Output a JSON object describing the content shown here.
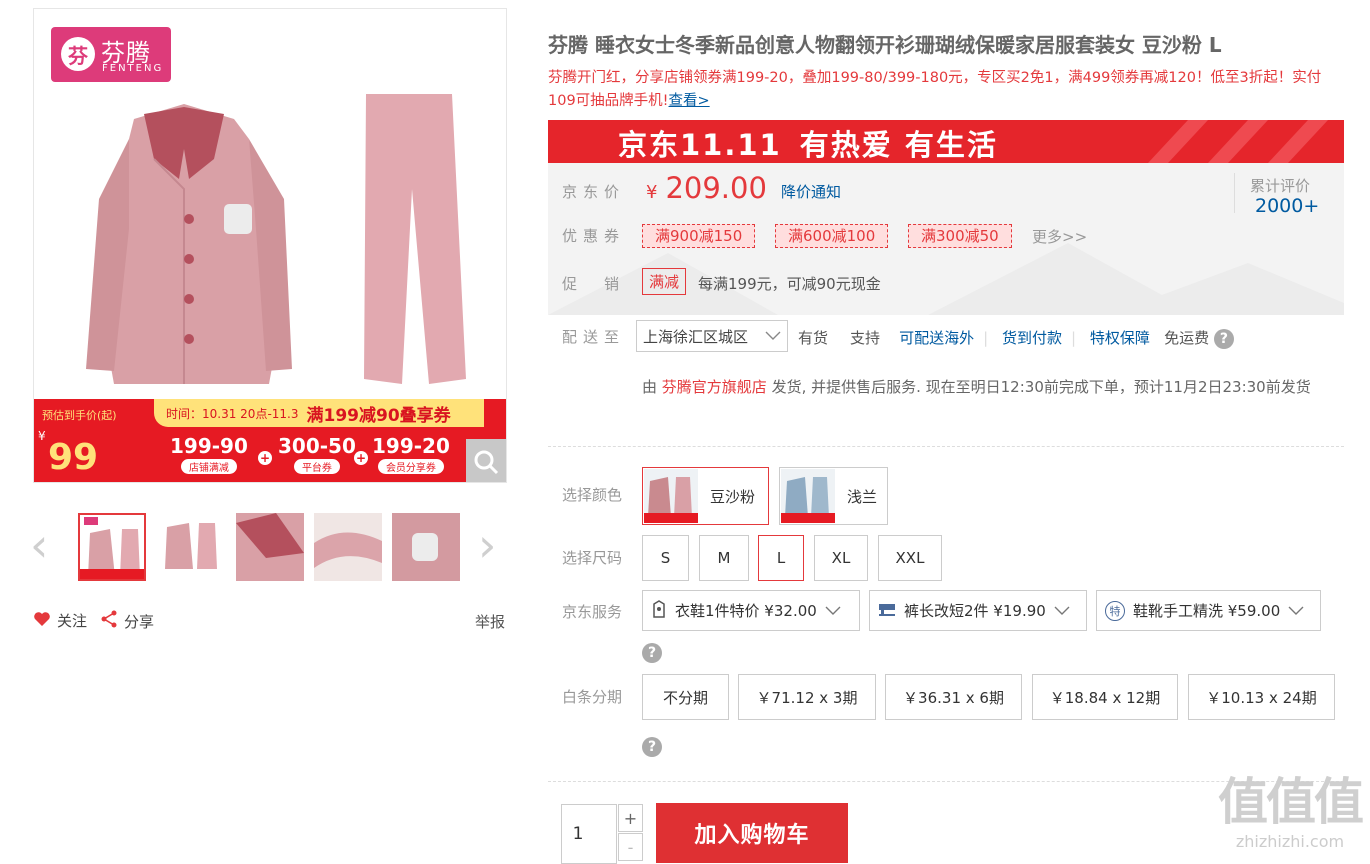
{
  "gallery": {
    "brand_logo": {
      "cn": "芬腾",
      "en": "FENTENG",
      "mark": "芬"
    },
    "promo_banner": {
      "estimate_label": "预估到手价(起)",
      "currency": "¥",
      "estimate_price": "99",
      "time_text": "时间：10.31 20点-11.3",
      "headline": "满199减90叠享券",
      "segments": [
        {
          "amount": "199-90",
          "sub": "店铺满减"
        },
        {
          "amount": "300-50",
          "sub": "平台券"
        },
        {
          "amount": "199-20",
          "sub": "会员分享券"
        }
      ],
      "plus": "+"
    },
    "zoom_icon": "magnifier-icon",
    "prev_arrow": "‹",
    "next_arrow": "›",
    "thumbnails_count": 5,
    "follow_label": "关注",
    "share_label": "分享",
    "report_label": "举报"
  },
  "product": {
    "title": "芬腾 睡衣女士冬季新品创意人物翻领开衫珊瑚绒保暖家居服套装女 豆沙粉 L",
    "slogan": "芬腾开门红，分享店铺领券满199-20，叠加199-80/399-180元，专区买2免1，满499领券再减120！低至3折起！实付109可抽品牌手机!",
    "slogan_link": "查看>",
    "banner_left": "京东11.11",
    "banner_right": "有热爱 有生活"
  },
  "pricing": {
    "price_label": "京东价",
    "currency": "¥",
    "price": "209.00",
    "price_notice": "降价通知",
    "review_label": "累计评价",
    "review_count": "2000+",
    "coupon_label": "优惠券",
    "coupons": [
      "满900减150",
      "满600减100",
      "满300减50"
    ],
    "coupons_more": "更多>>",
    "promo_label": "促销",
    "promo_tag": "满减",
    "promo_text": "每满199元，可减90元现金"
  },
  "delivery": {
    "label": "配送至",
    "region": "上海徐汇区城区",
    "stock": "有货",
    "support_label": "支持",
    "support_items": [
      "可配送海外",
      "货到付款",
      "特权保障"
    ],
    "free_shipping": "免运费",
    "ship_prefix": "由 ",
    "store": "芬腾官方旗舰店",
    "ship_text": " 发货, 并提供售后服务. 现在至明日12:30前完成下单，预计11月2日23:30前发货"
  },
  "options": {
    "color_label": "选择颜色",
    "colors": [
      {
        "name": "豆沙粉",
        "swatch": "#c98a8f",
        "selected": true
      },
      {
        "name": "浅兰",
        "swatch": "#9fb8cc",
        "selected": false
      }
    ],
    "size_label": "选择尺码",
    "sizes": [
      "S",
      "M",
      "L",
      "XL",
      "XXL"
    ],
    "selected_size": "L",
    "service_label": "京东服务",
    "services": [
      {
        "icon": "shirt-icon",
        "text": "衣鞋1件特价 ¥32.00"
      },
      {
        "icon": "sewing-machine-icon",
        "text": "裤长改短2件 ¥19.90"
      },
      {
        "icon": "special-badge-icon",
        "badge": "特",
        "text": "鞋靴手工精洗 ¥59.00"
      }
    ],
    "installment_label": "白条分期",
    "installments": [
      "不分期",
      "￥71.12 x 3期",
      "￥36.31 x 6期",
      "￥18.84 x 12期",
      "￥10.13 x 24期"
    ]
  },
  "cart": {
    "quantity": "1",
    "plus": "+",
    "minus": "-",
    "add_to_cart": "加入购物车"
  },
  "watermark": {
    "big": "值值值",
    "small": "zhizhizhi.com"
  },
  "colors": {
    "accent_red": "#e4393c",
    "link_blue": "#005aa0",
    "brand_pink": "#dd3b7a"
  }
}
